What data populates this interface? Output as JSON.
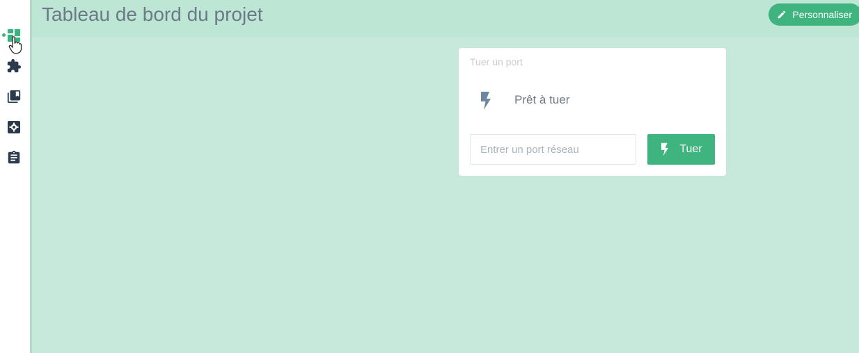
{
  "header": {
    "title": "Tableau de bord du projet",
    "customize_label": "Personnaliser"
  },
  "sidebar": {
    "items": [
      {
        "name": "dashboard",
        "icon": "dashboard-icon",
        "active": true
      },
      {
        "name": "plugins",
        "icon": "puzzle-icon"
      },
      {
        "name": "library",
        "icon": "library-icon"
      },
      {
        "name": "settings",
        "icon": "gear-icon"
      },
      {
        "name": "tasks",
        "icon": "clipboard-icon"
      }
    ]
  },
  "kill_port_widget": {
    "title": "Tuer un port",
    "status": "Prêt à tuer",
    "input_placeholder": "Entrer un port réseau",
    "input_value": "",
    "button_label": "Tuer"
  },
  "colors": {
    "accent": "#3fb47f",
    "background": "#c7e9dc",
    "header": "#bde6d5",
    "icon_dark": "#2b3b4c",
    "status_icon": "#6d87a3"
  }
}
